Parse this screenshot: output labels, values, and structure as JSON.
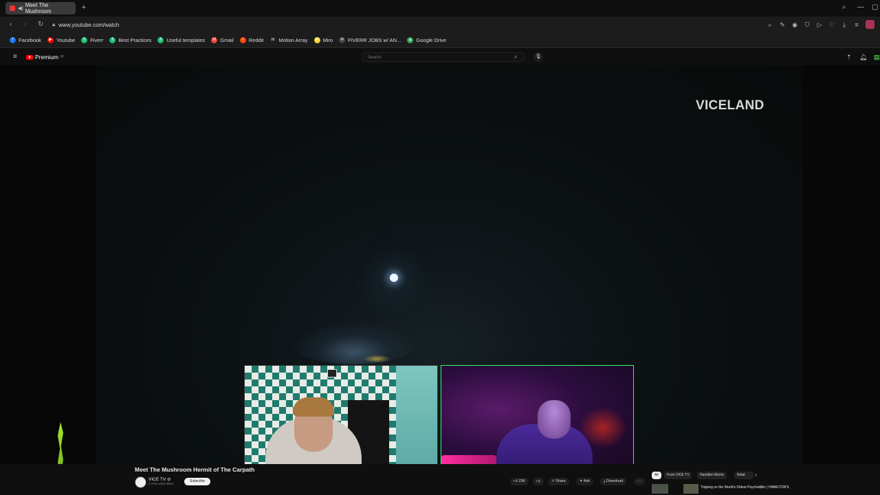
{
  "browser": {
    "tab_title": "Meet The Mushroom",
    "url": "www.youtube.com/watch",
    "new_tab": "+",
    "icons": [
      "back-icon",
      "forward-icon",
      "reload-icon",
      "lock-icon",
      "search-icon",
      "minimize-icon",
      "maximize-icon"
    ]
  },
  "bookmarks": [
    {
      "label": "Facebook",
      "color": "#1877f2",
      "glyph": "f"
    },
    {
      "label": "Youtube",
      "color": "#ff0000",
      "glyph": "▶"
    },
    {
      "label": "Fiverr",
      "color": "#1dbf73",
      "glyph": "fi"
    },
    {
      "label": "Best Practices",
      "color": "#1dbf73",
      "glyph": "fi"
    },
    {
      "label": "Useful templates",
      "color": "#1dbf73",
      "glyph": "fi"
    },
    {
      "label": "Gmail",
      "color": "#ea4335",
      "glyph": "M"
    },
    {
      "label": "Reddit",
      "color": "#ff4500",
      "glyph": "r"
    },
    {
      "label": "Motion Array",
      "color": "#222222",
      "glyph": "m"
    },
    {
      "label": "Miro",
      "color": "#ffd02f",
      "glyph": "M"
    },
    {
      "label": "FIVERR JOBS w/ AN...",
      "color": "#444444",
      "glyph": "✣"
    },
    {
      "label": "Google Drive",
      "color": "#34a853",
      "glyph": "▲"
    }
  ],
  "youtube": {
    "logo_text": "Premium",
    "logo_sup": "JP",
    "search_placeholder": "Search",
    "watermark": "VICELAND",
    "video_title": "Meet The Mushroom Hermit of The Carpath",
    "channel_name": "VICE TV ⊘",
    "channel_subs": "2.47M subscribers",
    "subscribe_label": "Subscribe",
    "actions": {
      "likes": "23K",
      "share": "Share",
      "ask": "Ask",
      "download": "Download",
      "more": "···"
    },
    "chips": [
      "All",
      "From VICE TV",
      "Hamilton Morris",
      "Relat"
    ],
    "chip_next": "›",
    "recommended_title": "Tripping on the World's Oldest Psychedelic | HAMILTON'S"
  }
}
